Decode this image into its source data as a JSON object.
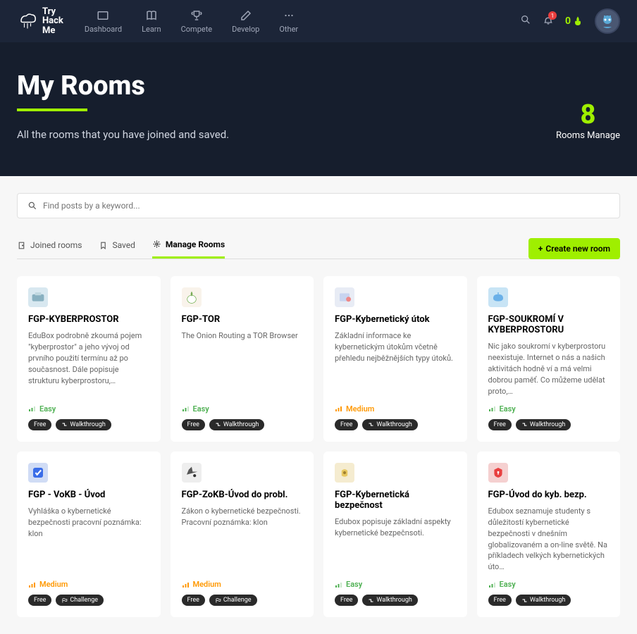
{
  "header": {
    "logo_text": "Try\nHack\nMe",
    "nav": [
      {
        "label": "Dashboard"
      },
      {
        "label": "Learn"
      },
      {
        "label": "Compete"
      },
      {
        "label": "Develop"
      },
      {
        "label": "Other"
      }
    ],
    "notification_count": "1",
    "streak": "0"
  },
  "hero": {
    "title": "My Rooms",
    "subtitle": "All the rooms that you have joined and saved.",
    "count": "8",
    "count_label": "Rooms Manage"
  },
  "search": {
    "placeholder": "Find posts by a keyword..."
  },
  "tabs": {
    "joined": "Joined rooms",
    "saved": "Saved",
    "manage": "Manage Rooms",
    "create": "Create new room"
  },
  "difficulty_labels": {
    "easy": "Easy",
    "medium": "Medium"
  },
  "pill_labels": {
    "free": "Free",
    "walkthrough": "Walkthrough",
    "challenge": "Challenge"
  },
  "rooms": [
    {
      "title": "FGP-KYBERPROSTOR",
      "desc": "EduBox podrobně zkoumá pojem \"kyberprostor\" a jeho vývoj od prvního použití termínu až po současnost. Dále popisuje strukturu kyberprostoru,…",
      "difficulty": "easy",
      "type": "walkthrough",
      "icon_bg": "#d8e8f0"
    },
    {
      "title": "FGP-TOR",
      "desc": "The Onion Routing a TOR Browser",
      "difficulty": "easy",
      "type": "walkthrough",
      "icon_bg": "#f9f3eb"
    },
    {
      "title": "FGP-Kybernetický útok",
      "desc": "Základní informace ke kybernetickým útokům včetně přehledu nejběžnějších typy útoků.",
      "difficulty": "medium",
      "type": "walkthrough",
      "icon_bg": "#e8ecf5"
    },
    {
      "title": "FGP-SOUKROMÍ V KYBERPROSTORU",
      "desc": "Nic jako soukromí v kyberprostoru neexistuje. Internet o nás a našich aktivitách hodně ví a má velmi dobrou paměť. Co můžeme udělat proto,…",
      "difficulty": "easy",
      "type": "walkthrough",
      "icon_bg": "#c8e4f5"
    },
    {
      "title": "FGP - VoKB - Úvod",
      "desc": "Vyhláška o kybernetické bezpečnosti pracovní poznámka: klon",
      "difficulty": "medium",
      "type": "challenge",
      "icon_bg": "#d0dcf5"
    },
    {
      "title": "FGP-ZoKB-Úvod do probl.",
      "desc": "Zákon o kybernetické bezpečnosti. Pracovní poznámka: klon",
      "difficulty": "medium",
      "type": "challenge",
      "icon_bg": "#eeeeee"
    },
    {
      "title": "FGP-Kybernetická bezpečnost",
      "desc": "Edubox popisuje základní aspekty kybernetické bezpečnsoti.",
      "difficulty": "easy",
      "type": "walkthrough",
      "icon_bg": "#f5ecd0"
    },
    {
      "title": "FGP-Úvod do kyb. bezp.",
      "desc": "Edubox seznamuje studenty s důležitostí kybernetické bezpečnosti v dnešním globalizovaném a on-line světě. Na příkladech velkých kybernetických úto…",
      "difficulty": "easy",
      "type": "walkthrough",
      "icon_bg": "#f5d0d0"
    }
  ]
}
